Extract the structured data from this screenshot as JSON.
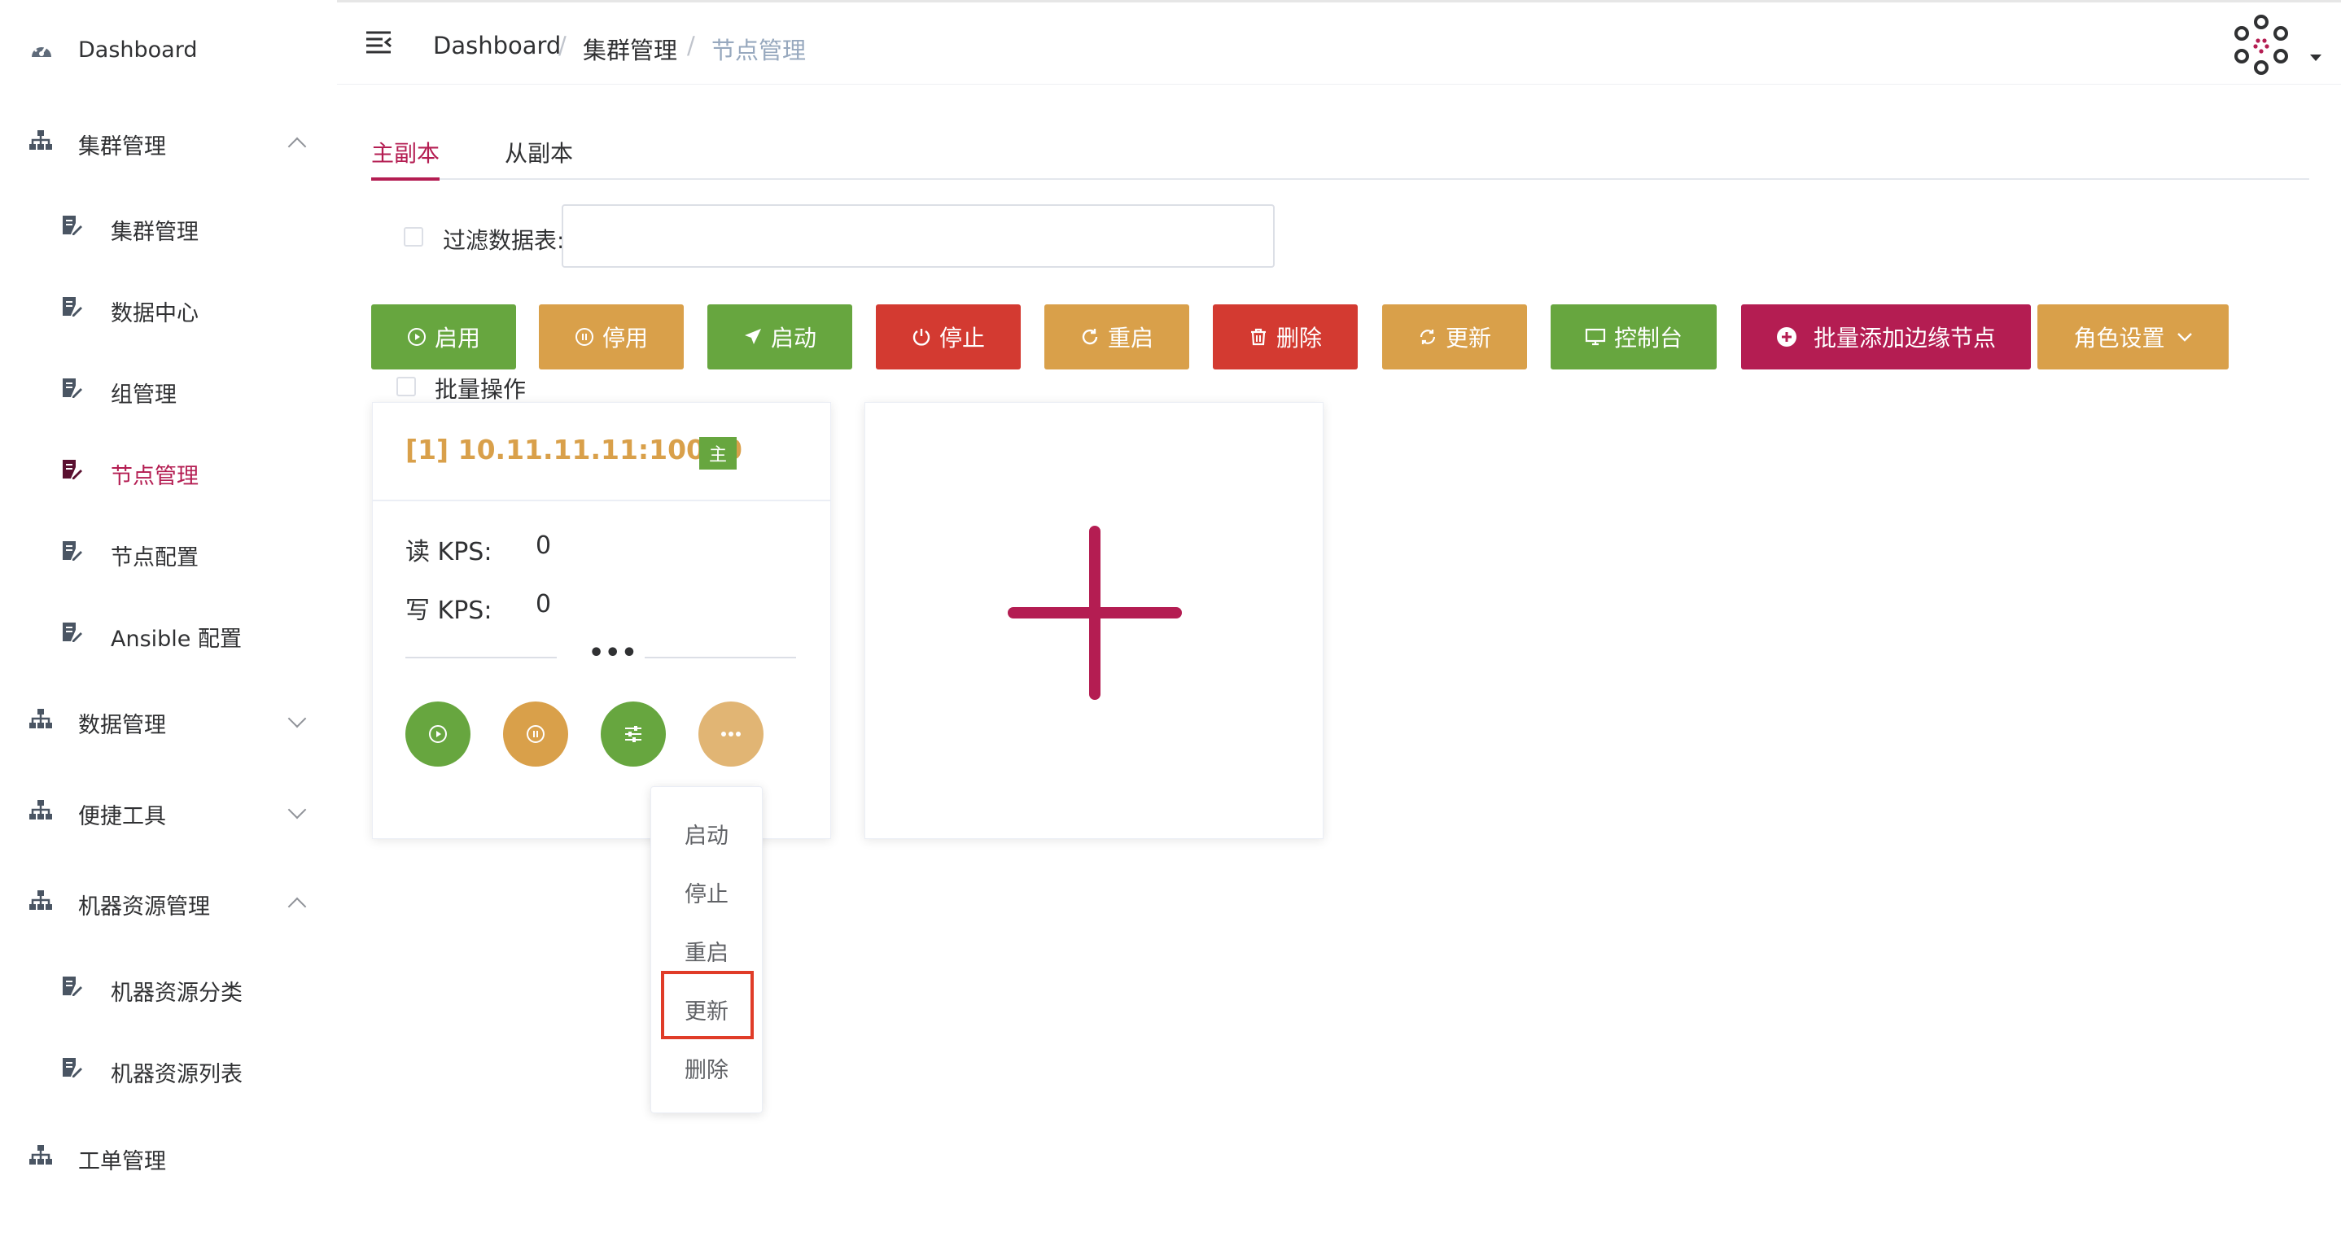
{
  "sidebar": {
    "items": [
      {
        "label": "Dashboard"
      },
      {
        "label": "集群管理"
      },
      {
        "label": "集群管理"
      },
      {
        "label": "数据中心"
      },
      {
        "label": "组管理"
      },
      {
        "label": "节点管理"
      },
      {
        "label": "节点配置"
      },
      {
        "label": "Ansible 配置"
      },
      {
        "label": "数据管理"
      },
      {
        "label": "便捷工具"
      },
      {
        "label": "机器资源管理"
      },
      {
        "label": "机器资源分类"
      },
      {
        "label": "机器资源列表"
      },
      {
        "label": "工单管理"
      }
    ]
  },
  "header": {
    "breadcrumb": [
      "Dashboard",
      "集群管理",
      "节点管理"
    ],
    "separator": "/"
  },
  "tabs": [
    {
      "label": "主副本"
    },
    {
      "label": "从副本"
    }
  ],
  "filter": {
    "label": "过滤数据表:",
    "value": ""
  },
  "toolbar": {
    "enable": "启用",
    "disable": "停用",
    "start": "启动",
    "stop": "停止",
    "restart": "重启",
    "delete": "删除",
    "update": "更新",
    "console": "控制台",
    "batch_add_edge": "批量添加边缘节点",
    "role_settings": "角色设置"
  },
  "batch": {
    "label": "批量操作"
  },
  "node_card": {
    "title": "[1] 10.11.11.11:10030",
    "badge": "主",
    "read_label": "读 KPS:",
    "read_value": "0",
    "write_label": "写 KPS:",
    "write_value": "0",
    "more": "•••"
  },
  "dropdown": {
    "items": [
      "启动",
      "停止",
      "重启",
      "更新",
      "删除"
    ]
  },
  "colors": {
    "primary": "#b41d52",
    "green": "#67a63f",
    "orange": "#d9a04a",
    "red": "#d33a31",
    "highlight": "#e03c28"
  }
}
